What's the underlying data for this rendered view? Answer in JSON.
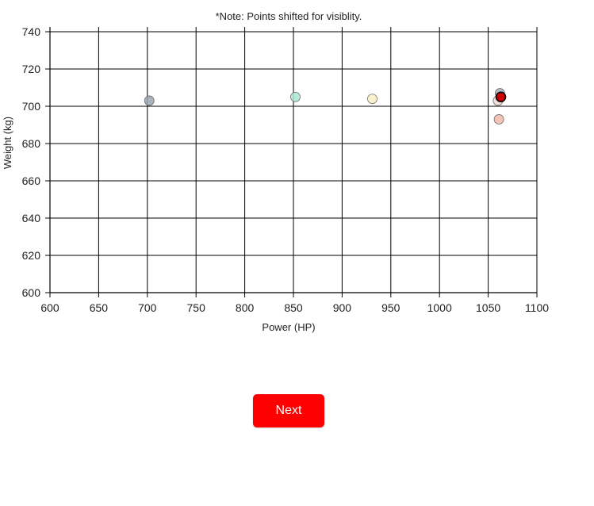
{
  "chart_data": {
    "type": "scatter",
    "title": "",
    "note": "*Note: Points shifted for visiblity.",
    "xlabel": "Power (HP)",
    "ylabel": "Weight (kg)",
    "xlim": [
      600,
      1100
    ],
    "ylim": [
      600,
      740
    ],
    "xticks": [
      600,
      650,
      700,
      750,
      800,
      850,
      900,
      950,
      1000,
      1050,
      1100
    ],
    "yticks": [
      600,
      620,
      640,
      660,
      680,
      700,
      720,
      740
    ],
    "grid": true,
    "points": [
      {
        "x": 702,
        "y": 703,
        "color": "#9aa6b2"
      },
      {
        "x": 852,
        "y": 705,
        "color": "#a8e6d2"
      },
      {
        "x": 931,
        "y": 704,
        "color": "#fbeec4"
      },
      {
        "x": 1060,
        "y": 703,
        "color": "#efd6d2"
      },
      {
        "x": 1062,
        "y": 707,
        "color": "#a8b0bb"
      },
      {
        "x": 1061,
        "y": 693,
        "color": "#f2b7aa"
      },
      {
        "x": 1063,
        "y": 705,
        "color": "#cc0000",
        "highlight": true
      }
    ]
  },
  "button": {
    "next_label": "Next"
  }
}
